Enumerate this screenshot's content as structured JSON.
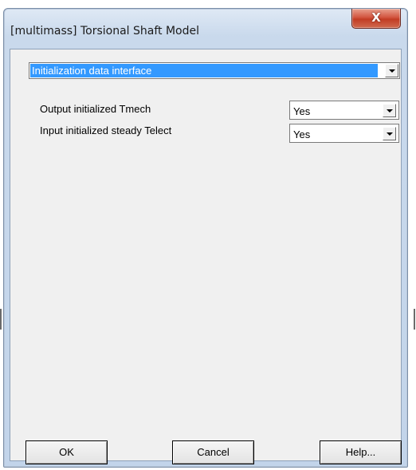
{
  "window": {
    "title": "[multimass] Torsional Shaft Model",
    "close_label": "X"
  },
  "section_dropdown": {
    "selected": "Initialization data interface"
  },
  "params": [
    {
      "label": "Output initialized Tmech",
      "value": "Yes"
    },
    {
      "label": "Input initialized steady Telect",
      "value": "Yes"
    }
  ],
  "buttons": {
    "ok": "OK",
    "cancel": "Cancel",
    "help": "Help..."
  },
  "colors": {
    "selection_highlight": "#3399ff",
    "close_button": "#c23c24",
    "dialog_background": "#f0f0f0"
  }
}
